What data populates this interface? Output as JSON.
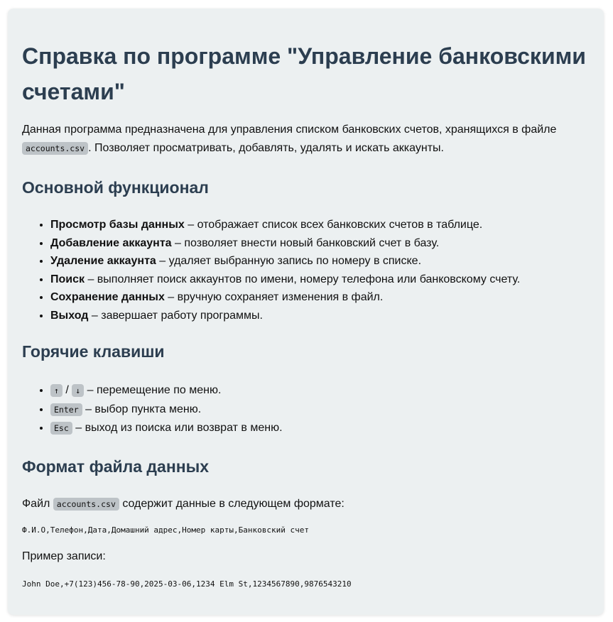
{
  "title": "Справка по программе \"Управление банковскими счетами\"",
  "intro": {
    "before": "Данная программа предназначена для управления списком банковских счетов, хранящихся в файле ",
    "file": "accounts.csv",
    "after": ". Позволяет просматривать, добавлять, удалять и искать аккаунты."
  },
  "functionality": {
    "heading": "Основной функционал",
    "items": [
      {
        "name": "Просмотр базы данных",
        "desc": " – отображает список всех банковских счетов в таблице."
      },
      {
        "name": "Добавление аккаунта",
        "desc": " – позволяет внести новый банковский счет в базу."
      },
      {
        "name": "Удаление аккаунта",
        "desc": " – удаляет выбранную запись по номеру в списке."
      },
      {
        "name": "Поиск",
        "desc": " – выполняет поиск аккаунтов по имени, номеру телефона или банковскому счету."
      },
      {
        "name": "Сохранение данных",
        "desc": " – вручную сохраняет изменения в файл."
      },
      {
        "name": "Выход",
        "desc": " – завершает работу программы."
      }
    ]
  },
  "hotkeys": {
    "heading": "Горячие клавиши",
    "up_key": "↑",
    "separator": " / ",
    "down_key": "↓",
    "arrows_desc": " – перемещение по меню.",
    "enter_key": "Enter",
    "enter_desc": " – выбор пункта меню.",
    "esc_key": "Esc",
    "esc_desc": " – выход из поиска или возврат в меню."
  },
  "format": {
    "heading": "Формат файла данных",
    "line_before": "Файл ",
    "file": "accounts.csv",
    "line_after": " содержит данные в следующем формате:",
    "schema": "Ф.И.О,Телефон,Дата,Домашний адрес,Номер карты,Банковский счет",
    "example_label": "Пример записи:",
    "example": "John Doe,+7(123)456-78-90,2025-03-06,1234 Elm St,1234567890,9876543210"
  }
}
